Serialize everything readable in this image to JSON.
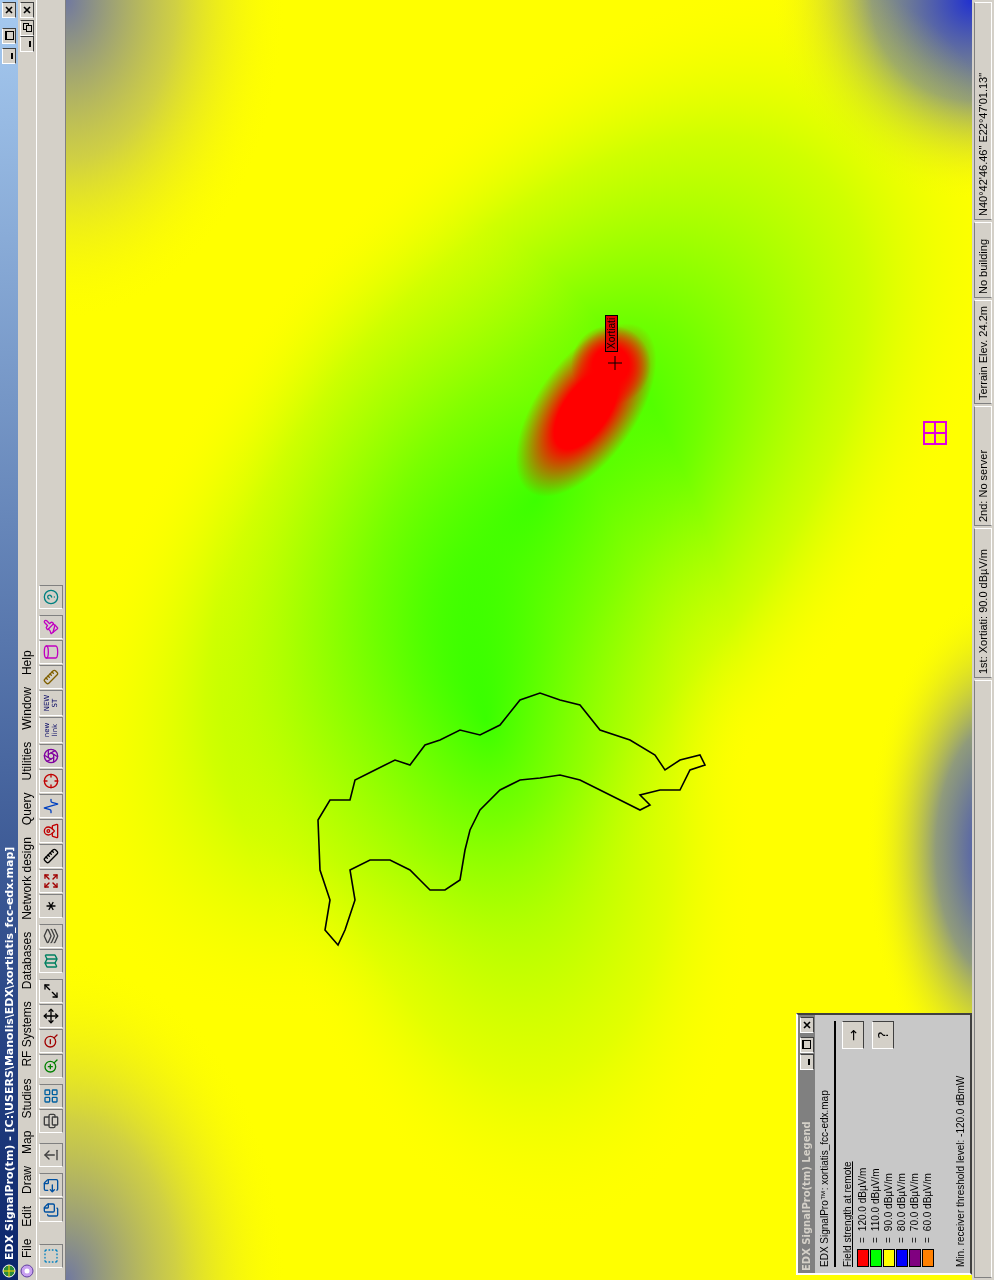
{
  "window": {
    "title": "EDX SignalPro(tm) - [C:\\USERS\\Manolis\\EDX\\xortiatis_fcc-edx.map]"
  },
  "menu": [
    "File",
    "Edit",
    "Draw",
    "Map",
    "Studies",
    "RF Systems",
    "Databases",
    "Network design",
    "Query",
    "Utilities",
    "Window",
    "Help"
  ],
  "toolbar": {
    "text_buttons": [
      "new link",
      "NEW ST"
    ]
  },
  "map": {
    "site_label": "Xortiati"
  },
  "legend": {
    "title": "EDX SignalPro(tm) Legend",
    "subtitle": "EDX SignalPro™: xortiatis_fcc-edx.map",
    "buttons": [
      "→",
      "?"
    ],
    "heading": "Field strength at remote",
    "levels": [
      {
        "color": "#ff0000",
        "sign": "=",
        "value": "120.0 dBµV/m"
      },
      {
        "color": "#00ff00",
        "sign": "=",
        "value": "110.0 dBµV/m"
      },
      {
        "color": "#ffff00",
        "sign": "=",
        "value": "90.0 dBµV/m"
      },
      {
        "color": "#0000ff",
        "sign": "=",
        "value": "80.0 dBµV/m"
      },
      {
        "color": "#800080",
        "sign": "=",
        "value": "70.0 dBµV/m"
      },
      {
        "color": "#ff8000",
        "sign": "=",
        "value": "60.0 dBµV/m"
      }
    ],
    "footer": "Min. receiver threshold level: -120.0 dBmW"
  },
  "status_bar": [
    "1st: Xortiati: 90.0 dBµV/m",
    "2nd: No server",
    "Terrain Elev. 24.2m",
    "No building",
    "N40°42'46.46\" E22°47'01.13\""
  ]
}
